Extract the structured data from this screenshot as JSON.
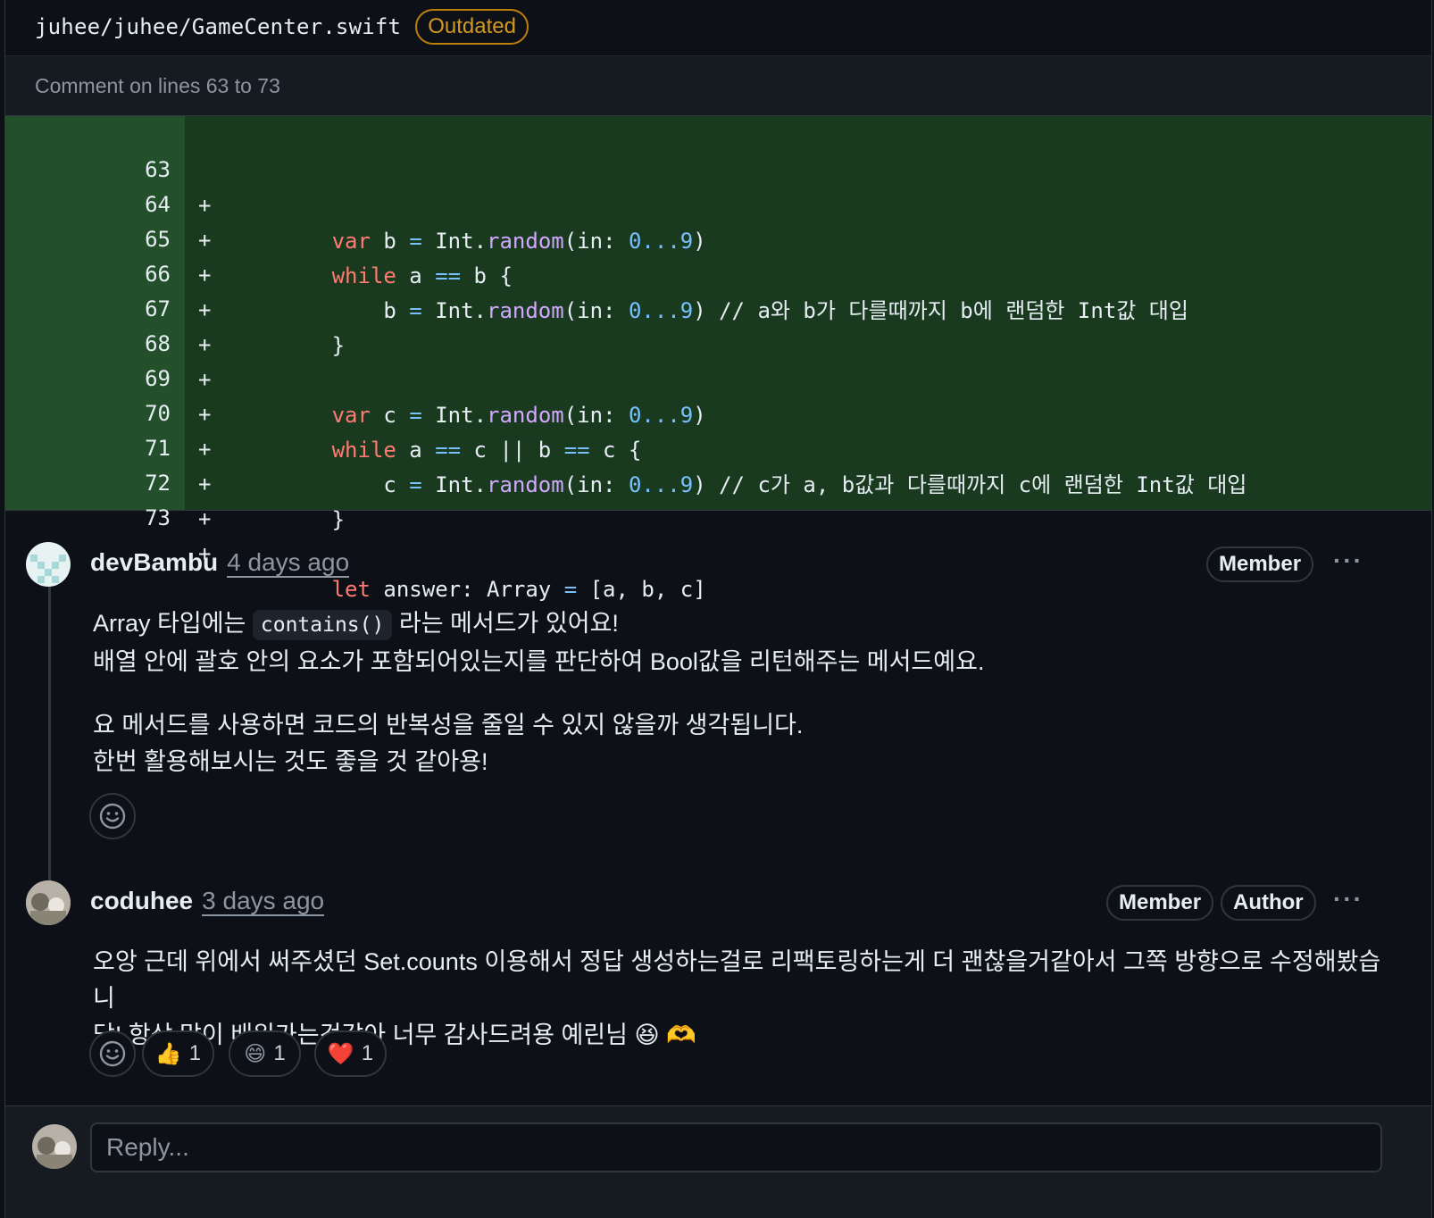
{
  "file": {
    "path": "juhee/juhee/GameCenter.swift",
    "status_badge": "Outdated",
    "comment_range": "Comment on lines 63 to 73"
  },
  "diff": {
    "lines": [
      {
        "num": "63",
        "sign": "+"
      },
      {
        "num": "64",
        "sign": "+"
      },
      {
        "num": "65",
        "sign": "+"
      },
      {
        "num": "66",
        "sign": "+"
      },
      {
        "num": "67",
        "sign": "+"
      },
      {
        "num": "68",
        "sign": "+"
      },
      {
        "num": "69",
        "sign": "+"
      },
      {
        "num": "70",
        "sign": "+"
      },
      {
        "num": "71",
        "sign": "+"
      },
      {
        "num": "72",
        "sign": "+"
      },
      {
        "num": "73",
        "sign": "+"
      }
    ],
    "code": {
      "l63": "var b = Int.random(in: 0...9)",
      "l64": "while a == b {",
      "l65": "b = Int.random(in: 0...9) // a와 b가 다를때까지 b에 랜덤한 Int값 대입",
      "l66": "}",
      "l68": "var c = Int.random(in: 0...9)",
      "l69": "while a == c || b == c {",
      "l70": "c = Int.random(in: 0...9) // c가 a, b값과 다를때까지 c에 랜덤한 Int값 대입",
      "l71": "}",
      "l73": "let answer: Array = [a, b, c]"
    }
  },
  "comments": [
    {
      "author": "devBambu",
      "time": "4 days ago",
      "badges": [
        "Member"
      ],
      "body": {
        "line1_pre": "Array 타입에는 ",
        "line1_code": "contains()",
        "line1_post": " 라는 메서드가 있어요!",
        "line2": "배열 안에 괄호 안의 요소가 포함되어있는지를 판단하여 Bool값을 리턴해주는 메서드예요.",
        "line3": "요 메서드를 사용하면 코드의 반복성을 줄일 수 있지 않을까 생각됩니다.",
        "line4": "한번 활용해보시는 것도 좋을 것 같아용!"
      }
    },
    {
      "author": "coduhee",
      "time": "3 days ago",
      "badges": [
        "Member",
        "Author"
      ],
      "body": {
        "line1": "오앙 근데 위에서 써주셨던 Set.counts 이용해서 정답 생성하는걸로 리팩토링하는게 더 괜찮을거같아서 그쪽 방향으로 수정해봤습니",
        "line2": "당! 항상 많이 배워가는것같아 너무 감사드려용 예린님",
        "emoji": "😆 🫶"
      },
      "reactions": [
        {
          "emoji": "👍",
          "count": "1"
        },
        {
          "emoji": "😄",
          "count": "1"
        },
        {
          "emoji": "❤️",
          "count": "1"
        }
      ]
    }
  ],
  "reply": {
    "placeholder": "Reply..."
  },
  "colors": {
    "diff_bg": "#1a3a20",
    "gutter_bg": "#23502b",
    "keyword": "#ff7b72",
    "function": "#d2a8ff",
    "number": "#79c0ff",
    "outdated": "#d29922"
  },
  "icons": {
    "more": "kebab-horizontal-icon",
    "add_reaction": "smiley-icon"
  }
}
